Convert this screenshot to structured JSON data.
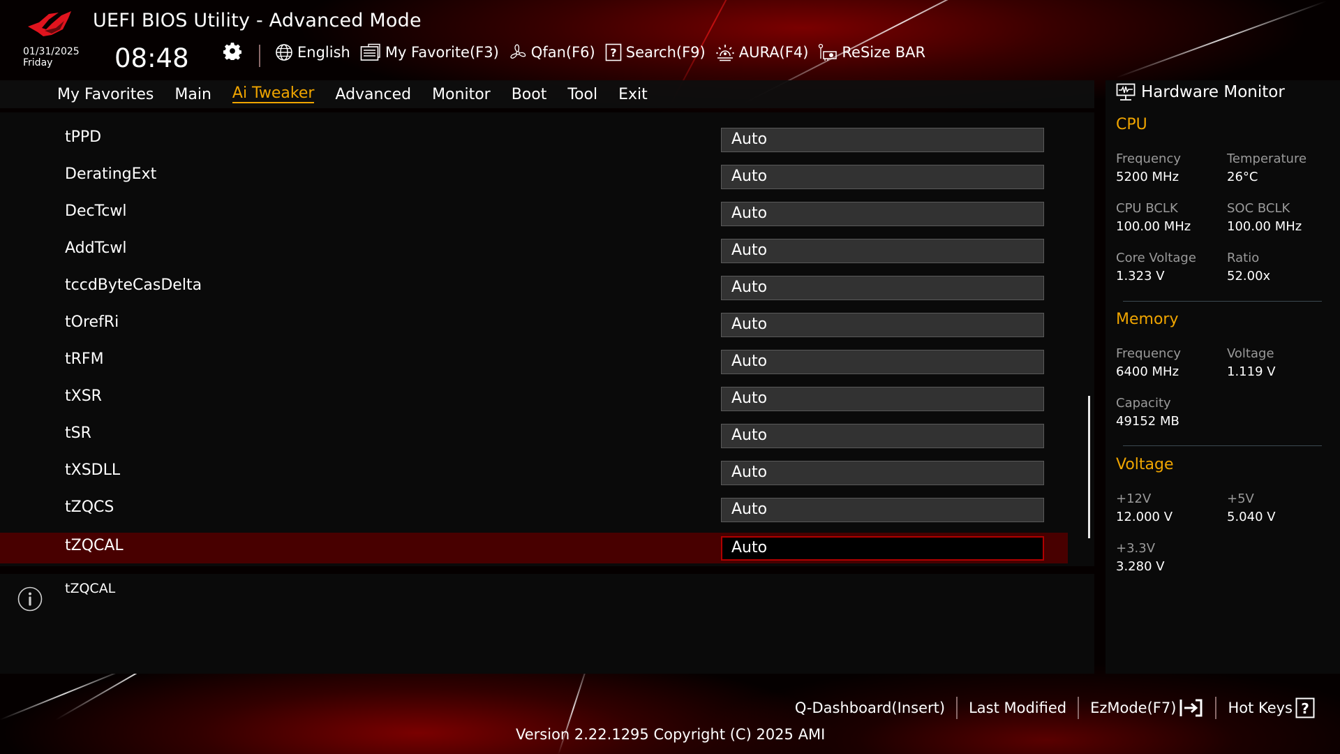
{
  "header": {
    "title": "UEFI BIOS Utility - Advanced Mode",
    "date": "01/31/2025",
    "day": "Friday",
    "time": "08:48",
    "toolbar": [
      {
        "icon": "globe-icon",
        "label": "English"
      },
      {
        "icon": "favorite-list-icon",
        "label": "My Favorite(F3)"
      },
      {
        "icon": "fan-icon",
        "label": "Qfan(F6)"
      },
      {
        "icon": "search-question-icon",
        "label": "Search(F9)"
      },
      {
        "icon": "aura-light-icon",
        "label": "AURA(F4)"
      },
      {
        "icon": "resize-bar-icon",
        "label": "ReSize BAR"
      }
    ]
  },
  "nav": {
    "tabs": [
      {
        "label": "My Favorites",
        "active": false
      },
      {
        "label": "Main",
        "active": false
      },
      {
        "label": "Ai Tweaker",
        "active": true
      },
      {
        "label": "Advanced",
        "active": false
      },
      {
        "label": "Monitor",
        "active": false
      },
      {
        "label": "Boot",
        "active": false
      },
      {
        "label": "Tool",
        "active": false
      },
      {
        "label": "Exit",
        "active": false
      }
    ]
  },
  "settings": [
    {
      "label": "tPPD",
      "value": "Auto"
    },
    {
      "label": "DeratingExt",
      "value": "Auto"
    },
    {
      "label": "DecTcwl",
      "value": "Auto"
    },
    {
      "label": "AddTcwl",
      "value": "Auto"
    },
    {
      "label": "tccdByteCasDelta",
      "value": "Auto"
    },
    {
      "label": "tOrefRi",
      "value": "Auto"
    },
    {
      "label": "tRFM",
      "value": "Auto"
    },
    {
      "label": "tXSR",
      "value": "Auto"
    },
    {
      "label": "tSR",
      "value": "Auto"
    },
    {
      "label": "tXSDLL",
      "value": "Auto"
    },
    {
      "label": "tZQCS",
      "value": "Auto"
    },
    {
      "label": "tZQCAL",
      "value": "Auto",
      "selected": true
    }
  ],
  "help": {
    "text": "tZQCAL"
  },
  "hardware_monitor": {
    "title": "Hardware Monitor",
    "cpu": {
      "heading": "CPU",
      "frequency_label": "Frequency",
      "frequency": "5200 MHz",
      "temperature_label": "Temperature",
      "temperature": "26°C",
      "cpu_bclk_label": "CPU BCLK",
      "cpu_bclk": "100.00 MHz",
      "soc_bclk_label": "SOC BCLK",
      "soc_bclk": "100.00 MHz",
      "core_voltage_label": "Core Voltage",
      "core_voltage": "1.323 V",
      "ratio_label": "Ratio",
      "ratio": "52.00x"
    },
    "memory": {
      "heading": "Memory",
      "frequency_label": "Frequency",
      "frequency": "6400 MHz",
      "voltage_label": "Voltage",
      "voltage": "1.119 V",
      "capacity_label": "Capacity",
      "capacity": "49152 MB"
    },
    "voltage": {
      "heading": "Voltage",
      "v12_label": "+12V",
      "v12": "12.000 V",
      "v5_label": "+5V",
      "v5": "5.040 V",
      "v33_label": "+3.3V",
      "v33": "3.280 V"
    }
  },
  "footer": {
    "links": [
      {
        "label": "Q-Dashboard(Insert)"
      },
      {
        "label": "Last Modified"
      },
      {
        "label": "EzMode(F7)"
      },
      {
        "label": "Hot Keys"
      }
    ],
    "version": "Version 2.22.1295 Copyright (C) 2025 AMI"
  },
  "colors": {
    "accent": "#f0a500",
    "selected_row": "#480000",
    "selected_border": "#b00000"
  }
}
